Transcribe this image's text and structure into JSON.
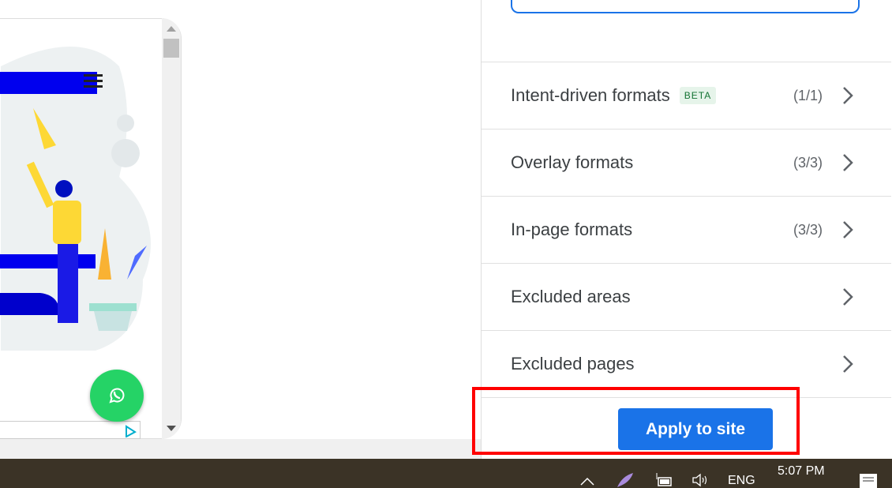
{
  "preview": {
    "whatsapp_icon": "whatsapp-icon",
    "ad_icon": "adchoices-icon",
    "menu_icon": "hamburger-icon"
  },
  "panel": {
    "rows": [
      {
        "label": "Intent-driven formats",
        "badge": "BETA",
        "count": "(1/1)"
      },
      {
        "label": "Overlay formats",
        "count": "(3/3)"
      },
      {
        "label": "In-page formats",
        "count": "(3/3)"
      },
      {
        "label": "Excluded areas"
      },
      {
        "label": "Excluded pages"
      }
    ],
    "apply_label": "Apply to site"
  },
  "colors": {
    "accent": "#1a73e8",
    "highlight": "#ff0000",
    "whatsapp": "#25d366"
  },
  "taskbar": {
    "language": "ENG",
    "time": "5:07 PM"
  }
}
